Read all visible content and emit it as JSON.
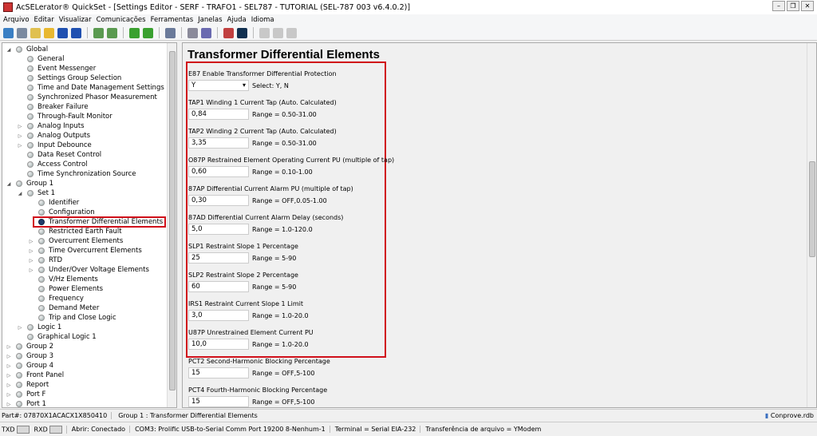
{
  "window": {
    "title": "AcSELerator® QuickSet - [Settings Editor - SERF - TRAFO1 - SEL787 - TUTORIAL (SEL-787 003 v6.4.0.2)]"
  },
  "menu": [
    "Arquivo",
    "Editar",
    "Visualizar",
    "Comunicações",
    "Ferramentas",
    "Janelas",
    "Ajuda",
    "Idioma"
  ],
  "toolbar_colors": [
    "#3a7fc4",
    "#7a8aa0",
    "#e0c050",
    "#e8b830",
    "#2050b0",
    "#2050b0",
    "sep",
    "#5a9a50",
    "#5a9a50",
    "sep",
    "#3aa030",
    "#3aa030",
    "sep",
    "#6a7a9a",
    "sep",
    "#8a8a9a",
    "#6a6ab0",
    "sep",
    "#c04040",
    "#103050",
    "sep",
    "#c8c8c8",
    "#c8c8c8",
    "#c8c8c8"
  ],
  "tree": [
    {
      "label": "Global",
      "level": 0,
      "exp": "open"
    },
    {
      "label": "General",
      "level": 1
    },
    {
      "label": "Event Messenger",
      "level": 1
    },
    {
      "label": "Settings Group Selection",
      "level": 1
    },
    {
      "label": "Time and Date Management Settings",
      "level": 1
    },
    {
      "label": "Synchronized Phasor Measurement",
      "level": 1
    },
    {
      "label": "Breaker Failure",
      "level": 1
    },
    {
      "label": "Through-Fault Monitor",
      "level": 1
    },
    {
      "label": "Analog Inputs",
      "level": 1,
      "exp": "closed"
    },
    {
      "label": "Analog Outputs",
      "level": 1,
      "exp": "closed"
    },
    {
      "label": "Input Debounce",
      "level": 1,
      "exp": "closed"
    },
    {
      "label": "Data Reset Control",
      "level": 1
    },
    {
      "label": "Access Control",
      "level": 1
    },
    {
      "label": "Time Synchronization Source",
      "level": 1
    },
    {
      "label": "Group 1",
      "level": 0,
      "exp": "open"
    },
    {
      "label": "Set 1",
      "level": 1,
      "exp": "open"
    },
    {
      "label": "Identifier",
      "level": 2
    },
    {
      "label": "Configuration",
      "level": 2
    },
    {
      "label": "Transformer Differential Elements",
      "level": 2,
      "selected": true
    },
    {
      "label": "Restricted Earth Fault",
      "level": 2
    },
    {
      "label": "Overcurrent Elements",
      "level": 2,
      "exp": "closed"
    },
    {
      "label": "Time Overcurrent Elements",
      "level": 2,
      "exp": "closed"
    },
    {
      "label": "RTD",
      "level": 2,
      "exp": "closed"
    },
    {
      "label": "Under/Over Voltage Elements",
      "level": 2,
      "exp": "closed"
    },
    {
      "label": "V/Hz Elements",
      "level": 2
    },
    {
      "label": "Power Elements",
      "level": 2
    },
    {
      "label": "Frequency",
      "level": 2
    },
    {
      "label": "Demand Meter",
      "level": 2
    },
    {
      "label": "Trip and Close Logic",
      "level": 2
    },
    {
      "label": "Logic 1",
      "level": 1,
      "exp": "closed"
    },
    {
      "label": "Graphical Logic 1",
      "level": 1
    },
    {
      "label": "Group 2",
      "level": 0,
      "exp": "closed"
    },
    {
      "label": "Group 3",
      "level": 0,
      "exp": "closed"
    },
    {
      "label": "Group 4",
      "level": 0,
      "exp": "closed"
    },
    {
      "label": "Front Panel",
      "level": 0,
      "exp": "closed"
    },
    {
      "label": "Report",
      "level": 0,
      "exp": "closed"
    },
    {
      "label": "Port F",
      "level": 0,
      "exp": "closed"
    },
    {
      "label": "Port 1",
      "level": 0,
      "exp": "closed"
    }
  ],
  "main": {
    "title": "Transformer Differential Elements",
    "fields": [
      {
        "label": "E87  Enable Transformer Differential Protection",
        "value": "Y",
        "range": "Select: Y, N",
        "type": "select"
      },
      {
        "label": "TAP1  Winding 1 Current Tap (Auto. Calculated)",
        "value": "0,84",
        "range": "Range = 0.50-31.00"
      },
      {
        "label": "TAP2  Winding 2 Current Tap (Auto. Calculated)",
        "value": "3,35",
        "range": "Range = 0.50-31.00"
      },
      {
        "label": "O87P  Restrained Element Operating Current PU (multiple of tap)",
        "value": "0,60",
        "range": "Range = 0.10-1.00"
      },
      {
        "label": "87AP  Differential Current Alarm PU (multiple of tap)",
        "value": "0,30",
        "range": "Range = OFF,0.05-1.00"
      },
      {
        "label": "87AD  Differential Current Alarm Delay (seconds)",
        "value": "5,0",
        "range": "Range = 1.0-120.0"
      },
      {
        "label": "SLP1  Restraint Slope 1 Percentage",
        "value": "25",
        "range": "Range = 5-90"
      },
      {
        "label": "SLP2  Restraint Slope 2 Percentage",
        "value": "60",
        "range": "Range = 5-90"
      },
      {
        "label": "IRS1  Restraint Current Slope 1 Limit",
        "value": "3,0",
        "range": "Range = 1.0-20.0"
      },
      {
        "label": "U87P  Unrestrained Element Current PU",
        "value": "10,0",
        "range": "Range = 1.0-20.0"
      },
      {
        "label": "PCT2  Second-Harmonic Blocking Percentage",
        "value": "15",
        "range": "Range = OFF,5-100"
      },
      {
        "label": "PCT4  Fourth-Harmonic Blocking Percentage",
        "value": "15",
        "range": "Range = OFF,5-100"
      }
    ]
  },
  "status1": {
    "part": "Part#: 07870X1ACACX1X850410",
    "location": "Group 1 : Transformer Differential Elements",
    "file": "Conprove.rdb"
  },
  "status2": {
    "txd": "TXD",
    "rxd": "RXD",
    "open": "Abrir: Conectado",
    "com": "COM3: Prolific USB-to-Serial Comm Port  19200  8-Nenhum-1",
    "terminal": "Terminal = Serial EIA-232",
    "transfer": "Transferência de arquivo = YModem"
  }
}
